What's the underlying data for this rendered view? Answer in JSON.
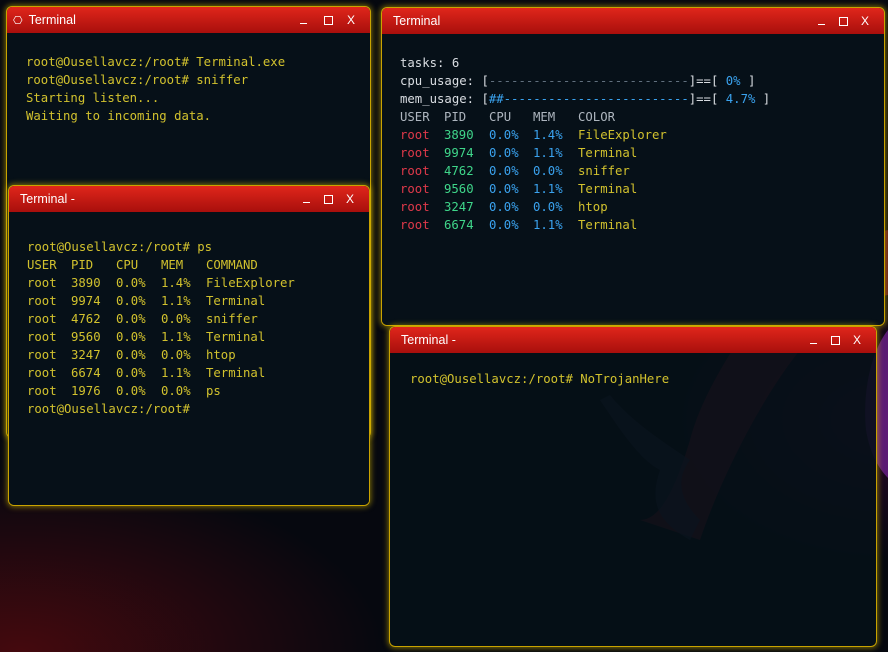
{
  "windows": {
    "win1": {
      "title": "Terminal",
      "icon": "terminal-app-icon",
      "lines": [
        "root@Ousellavcz:/root# Terminal.exe",
        "root@Ousellavcz:/root# sniffer",
        "Starting listen...",
        "Waiting to incoming data."
      ]
    },
    "win2": {
      "title": "Terminal -",
      "prompt_line": "root@Ousellavcz:/root# ps",
      "headers": [
        "USER",
        "PID",
        "CPU",
        "MEM",
        "COMMAND"
      ],
      "rows": [
        [
          "root",
          "3890",
          "0.0%",
          "1.4%",
          "FileExplorer"
        ],
        [
          "root",
          "9974",
          "0.0%",
          "1.1%",
          "Terminal"
        ],
        [
          "root",
          "4762",
          "0.0%",
          "0.0%",
          "sniffer"
        ],
        [
          "root",
          "9560",
          "0.0%",
          "1.1%",
          "Terminal"
        ],
        [
          "root",
          "3247",
          "0.0%",
          "0.0%",
          "htop"
        ],
        [
          "root",
          "6674",
          "0.0%",
          "1.1%",
          "Terminal"
        ],
        [
          "root",
          "1976",
          "0.0%",
          "0.0%",
          "ps"
        ]
      ],
      "last_prompt": "root@Ousellavcz:/root#"
    },
    "win3": {
      "title": "Terminal",
      "tasks": "tasks: 6",
      "cpu_label": "cpu_usage: ",
      "cpu_bar_open": "[",
      "cpu_bar": "---------------------------",
      "cpu_bar_close": "]==[",
      "cpu_value": " 0% ",
      "cpu_end": "]",
      "mem_label": "mem_usage: ",
      "mem_bar_open": "[",
      "mem_bar": "##-------------------------",
      "mem_bar_close": "]==[",
      "mem_value": " 4.7% ",
      "mem_end": "]",
      "headers": [
        "USER",
        "PID",
        "CPU",
        "MEM",
        "COLOR"
      ],
      "rows": [
        [
          "root",
          "3890",
          "0.0%",
          "1.4%",
          "FileExplorer"
        ],
        [
          "root",
          "9974",
          "0.0%",
          "1.1%",
          "Terminal"
        ],
        [
          "root",
          "4762",
          "0.0%",
          "0.0%",
          "sniffer"
        ],
        [
          "root",
          "9560",
          "0.0%",
          "1.1%",
          "Terminal"
        ],
        [
          "root",
          "3247",
          "0.0%",
          "0.0%",
          "htop"
        ],
        [
          "root",
          "6674",
          "0.0%",
          "1.1%",
          "Terminal"
        ]
      ]
    },
    "win4": {
      "title": "Terminal -",
      "lines": [
        "root@Ousellavcz:/root# NoTrojanHere"
      ]
    }
  },
  "controls": {
    "minimize": "_",
    "close": "X"
  },
  "colors": {
    "titlebar": "#d01d15",
    "border": "#c9a300",
    "terminal_bg": "#061018"
  }
}
